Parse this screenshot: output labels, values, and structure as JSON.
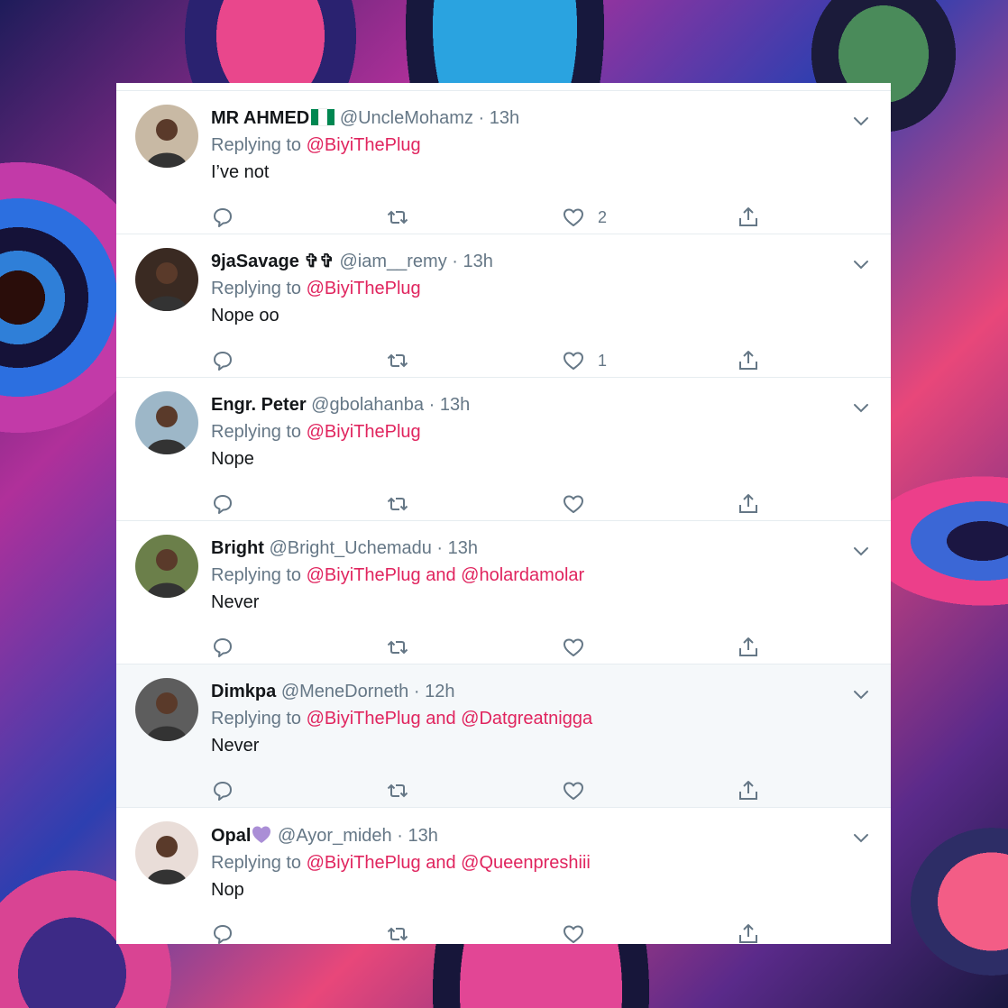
{
  "replying_label": "Replying to",
  "and_label": "and",
  "tweets": [
    {
      "name": "MR AHMED",
      "handle": "@UncleMohamz",
      "time": "13h",
      "reply_to": "@BiyiThePlug",
      "reply_to_2": "",
      "text": "I’ve not",
      "likes": "2",
      "emoji": "nigeria-flag",
      "avatar_color": "#c8b9a4"
    },
    {
      "name": "9jaSavage ✞✞",
      "handle": "@iam__remy",
      "time": "13h",
      "reply_to": "@BiyiThePlug",
      "reply_to_2": "",
      "text": "Nope oo",
      "likes": "1",
      "emoji": "",
      "avatar_color": "#3a2a22"
    },
    {
      "name": "Engr. Peter",
      "handle": "@gbolahanba",
      "time": "13h",
      "reply_to": "@BiyiThePlug",
      "reply_to_2": "",
      "text": "Nope",
      "likes": "",
      "emoji": "",
      "avatar_color": "#9db7c8"
    },
    {
      "name": "Bright",
      "handle": "@Bright_Uchemadu",
      "time": "13h",
      "reply_to": "@BiyiThePlug",
      "reply_to_2": "@holardamolar",
      "text": "Never",
      "likes": "",
      "emoji": "",
      "avatar_color": "#6b7f4a"
    },
    {
      "name": "Dimkpa",
      "handle": "@MeneDorneth",
      "time": "12h",
      "reply_to": "@BiyiThePlug",
      "reply_to_2": "@Datgreatnigga",
      "text": "Never",
      "likes": "",
      "emoji": "",
      "avatar_color": "#5d5d5d"
    },
    {
      "name": "Opal",
      "handle": "@Ayor_mideh",
      "time": "13h",
      "reply_to": "@BiyiThePlug",
      "reply_to_2": "@Queenpreshiii",
      "text": "Nop",
      "likes": "",
      "emoji": "purple-heart",
      "avatar_color": "#e9ddd8"
    }
  ],
  "icons": {
    "reply": "speech-bubble-icon",
    "retweet": "retweet-icon",
    "like": "heart-icon",
    "share": "share-icon",
    "more": "chevron-down-icon"
  },
  "colors": {
    "link": "#e0245e",
    "muted": "#657786",
    "text": "#14171a",
    "highlight_row": "#f5f8fa"
  }
}
